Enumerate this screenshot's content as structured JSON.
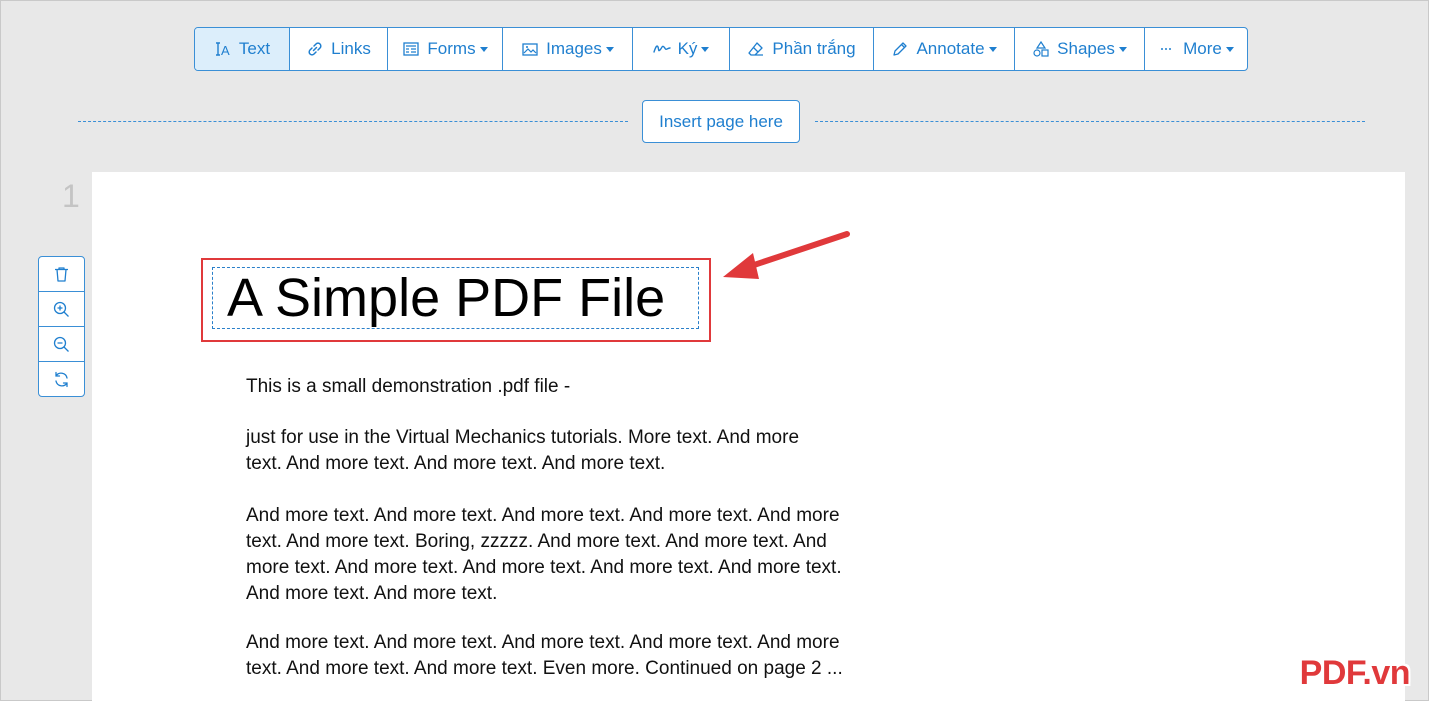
{
  "toolbar": {
    "items": [
      {
        "label": "Text",
        "icon": "text-cursor-icon"
      },
      {
        "label": "Links",
        "icon": "link-icon"
      },
      {
        "label": "Forms",
        "icon": "form-icon"
      },
      {
        "label": "Images",
        "icon": "image-icon"
      },
      {
        "label": "Ký",
        "icon": "signature-icon"
      },
      {
        "label": "Phần trắng",
        "icon": "eraser-icon"
      },
      {
        "label": "Annotate",
        "icon": "pencil-icon"
      },
      {
        "label": "Shapes",
        "icon": "shapes-icon"
      },
      {
        "label": "More",
        "icon": "ellipsis-icon"
      }
    ]
  },
  "insert_page": {
    "label": "Insert page here"
  },
  "page": {
    "number": "1",
    "title": "A Simple PDF File",
    "paragraphs": [
      "This is a small demonstration .pdf file -",
      "just for use in the Virtual Mechanics tutorials. More text. And more\ntext. And more text. And more text. And more text.",
      "And more text. And more text. And more text. And more text. And more\ntext. And more text. Boring, zzzzz. And more text. And more text. And\nmore text. And more text. And more text. And more text. And more text.\nAnd more text. And more text.",
      "And more text. And more text. And more text. And more text. And more\ntext. And more text. And more text. Even more. Continued on page 2 ..."
    ]
  },
  "side_tools": {
    "icons": [
      "trash-icon",
      "zoom-in-icon",
      "zoom-out-icon",
      "rotate-icon"
    ]
  },
  "watermark": "PDF.vn",
  "colors": {
    "accent": "#1f7fcf",
    "highlight": "#e0393b",
    "background": "#e8e8e8"
  }
}
